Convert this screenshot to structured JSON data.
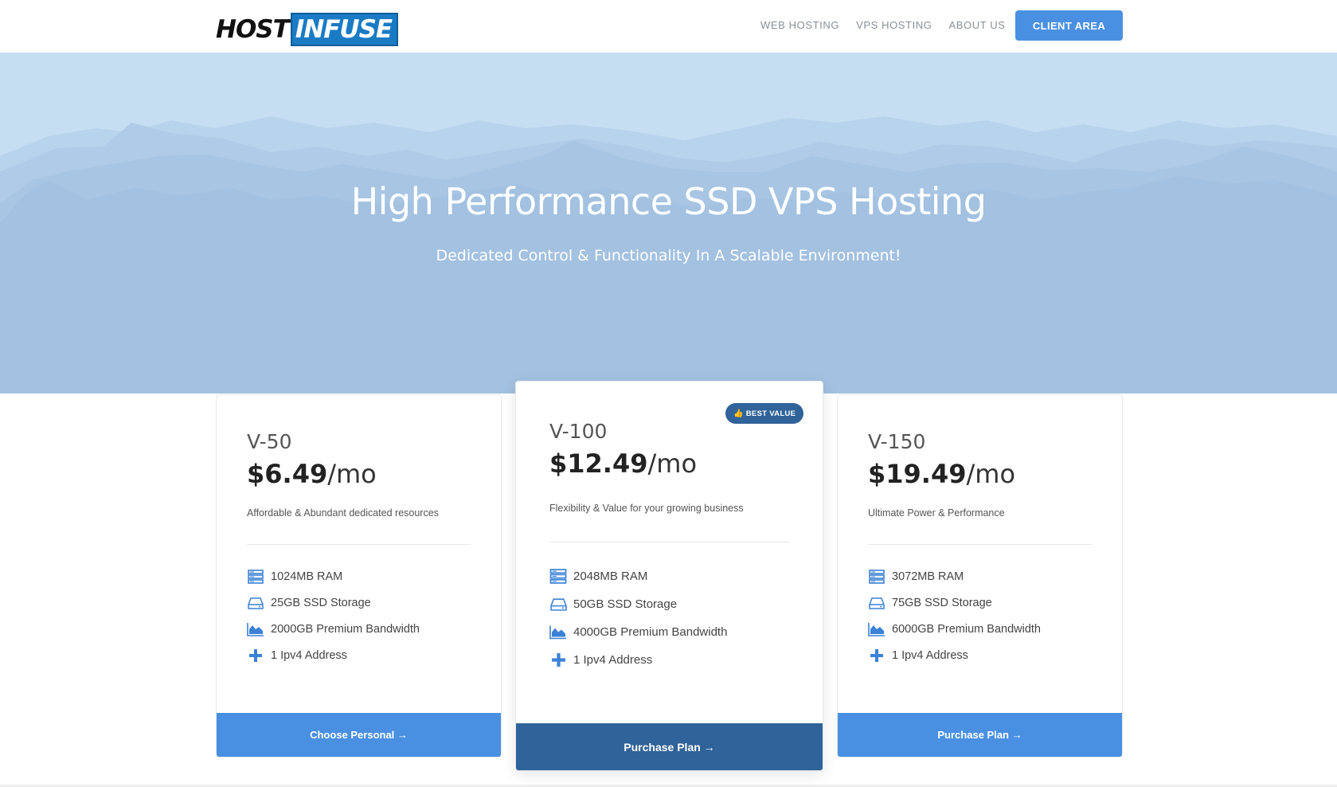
{
  "nav": {
    "logo_host": "HOST",
    "logo_infuse": "INFUSE",
    "links": [
      "WEB HOSTING",
      "VPS HOSTING",
      "ABOUT US"
    ],
    "client_area": "CLIENT AREA"
  },
  "hero": {
    "title": "High Performance SSD VPS Hosting",
    "subtitle": "Dedicated Control & Functionality In A Scalable Environment!"
  },
  "plans": [
    {
      "name": "V-50",
      "price": "$6.49",
      "unit": "/mo",
      "description": "Affordable & Abundant dedicated resources",
      "features": [
        "1024MB RAM",
        "25GB SSD Storage",
        "2000GB Premium Bandwidth",
        "1 Ipv4 Address"
      ],
      "button": "Choose Personal →"
    },
    {
      "name": "V-100",
      "price": "$12.49",
      "unit": "/mo",
      "description": "Flexibility & Value for your growing business",
      "features": [
        "2048MB RAM",
        "50GB SSD Storage",
        "4000GB Premium Bandwidth",
        "1 Ipv4 Address"
      ],
      "button": "Purchase Plan →",
      "badge": "BEST VALUE"
    },
    {
      "name": "V-150",
      "price": "$19.49",
      "unit": "/mo",
      "description": "Ultimate Power & Performance",
      "features": [
        "3072MB RAM",
        "75GB SSD Storage",
        "6000GB Premium Bandwidth",
        "1 Ipv4 Address"
      ],
      "button": "Purchase Plan →"
    }
  ],
  "feature_icons": [
    "server-icon",
    "hdd-icon",
    "area-chart-icon",
    "plus-icon"
  ],
  "colors": {
    "accent": "#4a90e2",
    "accent_dark": "#2f6399",
    "hero_bg": "#c6def2",
    "icon_blue": "#3b82d6"
  }
}
